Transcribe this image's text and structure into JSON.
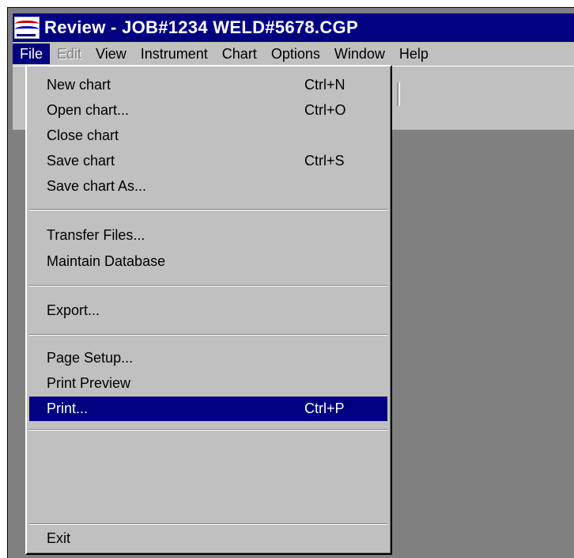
{
  "window": {
    "title": "Review - JOB#1234 WELD#5678.CGP"
  },
  "menubar": {
    "items": [
      {
        "label": "File",
        "state": "open"
      },
      {
        "label": "Edit",
        "state": "disabled"
      },
      {
        "label": "View",
        "state": "normal"
      },
      {
        "label": "Instrument",
        "state": "normal"
      },
      {
        "label": "Chart",
        "state": "normal"
      },
      {
        "label": "Options",
        "state": "normal"
      },
      {
        "label": "Window",
        "state": "normal"
      },
      {
        "label": "Help",
        "state": "normal"
      }
    ]
  },
  "file_menu": {
    "items": [
      {
        "label": "New chart",
        "shortcut": "Ctrl+N"
      },
      {
        "label": "Open chart...",
        "shortcut": "Ctrl+O"
      },
      {
        "label": "Close chart",
        "shortcut": ""
      },
      {
        "label": "Save chart",
        "shortcut": "Ctrl+S"
      },
      {
        "label": "Save chart As...",
        "shortcut": ""
      },
      {
        "label": "Transfer Files...",
        "shortcut": ""
      },
      {
        "label": "Maintain Database",
        "shortcut": ""
      },
      {
        "label": "Export...",
        "shortcut": ""
      },
      {
        "label": "Page Setup...",
        "shortcut": ""
      },
      {
        "label": "Print Preview",
        "shortcut": ""
      },
      {
        "label": "Print...",
        "shortcut": "Ctrl+P",
        "selected": true
      },
      {
        "label": "Exit",
        "shortcut": ""
      }
    ]
  },
  "colors": {
    "titlebar": "#000080",
    "menu_face": "#c0c0c0",
    "workspace": "#808080",
    "highlight": "#000080"
  },
  "icons": {
    "app": "review-app-icon"
  }
}
